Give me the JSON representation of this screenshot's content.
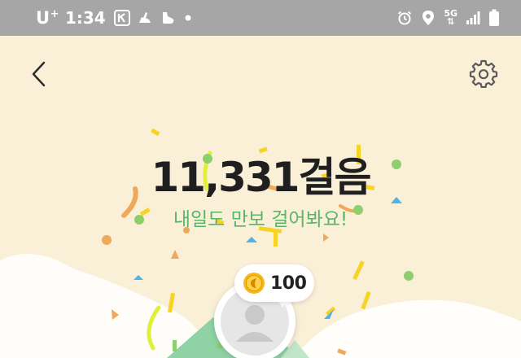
{
  "status_bar": {
    "carrier": "U",
    "carrier_superscript": "+",
    "time": "1:34",
    "network_type": "5G",
    "icons": [
      "k-app-icon",
      "running-shoe-icon",
      "sneaker-icon",
      "notification-dot-icon",
      "alarm-icon",
      "location-pin-icon",
      "signal-strength-icon",
      "battery-icon"
    ]
  },
  "nav": {
    "back_icon": "chevron-left-icon",
    "settings_icon": "gear-icon"
  },
  "main": {
    "steps_count": "11,331",
    "steps_unit": "걸음",
    "subtitle": "내일도 만보 걸어봐요!"
  },
  "reward": {
    "icon": "coin-icon",
    "amount": "100"
  },
  "avatar": {
    "icon": "person-icon"
  },
  "colors": {
    "background": "#faefd7",
    "status_bar": "#a6a6a6",
    "subtitle_green": "#59b568",
    "coin_gold": "#f5b817",
    "confetti_yellow": "#f7d325",
    "confetti_green": "#8fcf6b",
    "confetti_orange": "#f0a85a",
    "confetti_blue": "#4fb3e8",
    "hill_green": "#7fc99a"
  }
}
